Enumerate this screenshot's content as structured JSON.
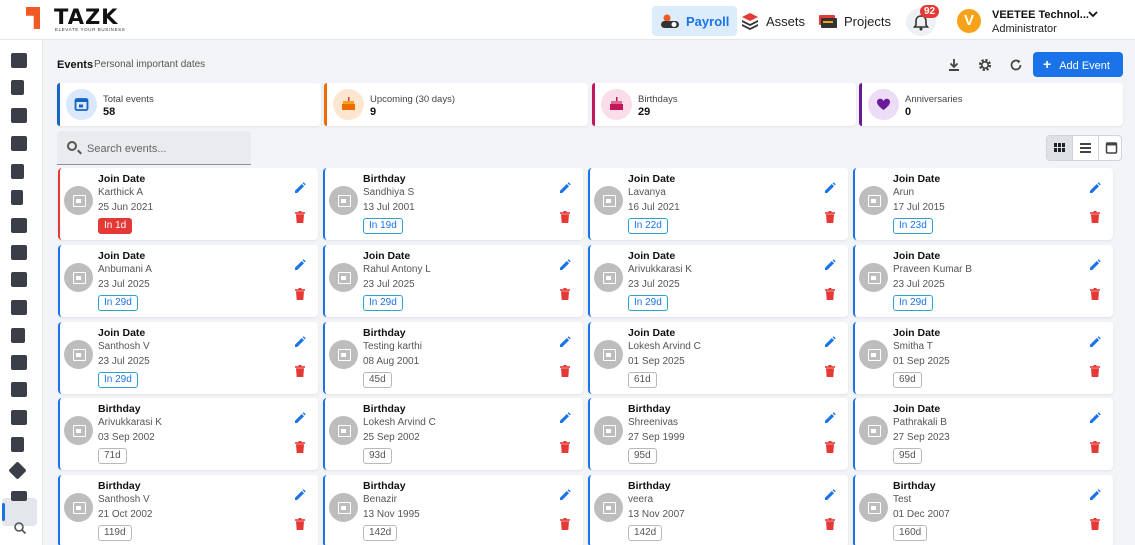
{
  "header": {
    "logo_text": "TAZK",
    "logo_tagline": "ELEVATE YOUR BUSINESS",
    "nav": [
      {
        "label": "Payroll",
        "active": true
      },
      {
        "label": "Assets",
        "active": false
      },
      {
        "label": "Projects",
        "active": false
      }
    ],
    "notifications_count": "92",
    "avatar_initial": "V",
    "user_name": "VEETEE Technol...",
    "user_role": "Administrator"
  },
  "page": {
    "title": "Events",
    "subtitle": "Personal important dates",
    "add_button": "Add Event"
  },
  "stats": [
    {
      "label": "Total events",
      "value": "58",
      "color": "#1565c0",
      "icon": "calendar-icon"
    },
    {
      "label": "Upcoming (30 days)",
      "value": "9",
      "color": "#ef6c00",
      "icon": "cake-icon"
    },
    {
      "label": "Birthdays",
      "value": "29",
      "color": "#c2185b",
      "icon": "birthday-cake-icon"
    },
    {
      "label": "Anniversaries",
      "value": "0",
      "color": "#6a1b9a",
      "icon": "heart-icon"
    }
  ],
  "search": {
    "placeholder": "Search events..."
  },
  "events": [
    {
      "type": "Join Date",
      "name": "Karthick A",
      "date": "25 Jun 2021",
      "chip": "In 1d",
      "status": "today"
    },
    {
      "type": "Birthday",
      "name": "Sandhiya S",
      "date": "13 Jul 2001",
      "chip": "In 19d",
      "status": "upcoming"
    },
    {
      "type": "Join Date",
      "name": "Lavanya",
      "date": "16 Jul 2021",
      "chip": "In 22d",
      "status": "upcoming"
    },
    {
      "type": "Join Date",
      "name": "Arun",
      "date": "17 Jul 2015",
      "chip": "In 23d",
      "status": "upcoming"
    },
    {
      "type": "Join Date",
      "name": "Anbumani A",
      "date": "23 Jul 2025",
      "chip": "In 29d",
      "status": "upcoming"
    },
    {
      "type": "Join Date",
      "name": "Rahul Antony L",
      "date": "23 Jul 2025",
      "chip": "In 29d",
      "status": "upcoming"
    },
    {
      "type": "Join Date",
      "name": "Arivukkarasi K",
      "date": "23 Jul 2025",
      "chip": "In 29d",
      "status": "upcoming"
    },
    {
      "type": "Join Date",
      "name": "Praveen Kumar B",
      "date": "23 Jul 2025",
      "chip": "In 29d",
      "status": "upcoming"
    },
    {
      "type": "Join Date",
      "name": "Santhosh V",
      "date": "23 Jul 2025",
      "chip": "In 29d",
      "status": "upcoming"
    },
    {
      "type": "Birthday",
      "name": "Testing karthi",
      "date": "08 Aug 2001",
      "chip": "45d",
      "status": "later"
    },
    {
      "type": "Join Date",
      "name": "Lokesh Arvind C",
      "date": "01 Sep 2025",
      "chip": "61d",
      "status": "later"
    },
    {
      "type": "Join Date",
      "name": "Smitha T",
      "date": "01 Sep 2025",
      "chip": "69d",
      "status": "later"
    },
    {
      "type": "Birthday",
      "name": "Arivukkarasi K",
      "date": "03 Sep 2002",
      "chip": "71d",
      "status": "later"
    },
    {
      "type": "Birthday",
      "name": "Lokesh Arvind C",
      "date": "25 Sep 2002",
      "chip": "93d",
      "status": "later"
    },
    {
      "type": "Birthday",
      "name": "Shreenivas",
      "date": "27 Sep 1999",
      "chip": "95d",
      "status": "later"
    },
    {
      "type": "Join Date",
      "name": "Pathrakali B",
      "date": "27 Sep 2023",
      "chip": "95d",
      "status": "later"
    },
    {
      "type": "Birthday",
      "name": "Santhosh V",
      "date": "21 Oct 2002",
      "chip": "119d",
      "status": "later"
    },
    {
      "type": "Birthday",
      "name": "Benazir",
      "date": "13 Nov 1995",
      "chip": "142d",
      "status": "later"
    },
    {
      "type": "Birthday",
      "name": "veera",
      "date": "13 Nov 2007",
      "chip": "142d",
      "status": "later"
    },
    {
      "type": "Birthday",
      "name": "Test",
      "date": "01 Dec 2007",
      "chip": "160d",
      "status": "later"
    }
  ],
  "colors": {
    "accent": "#1a73e8",
    "danger": "#e53935",
    "brand": "#f15a24"
  }
}
